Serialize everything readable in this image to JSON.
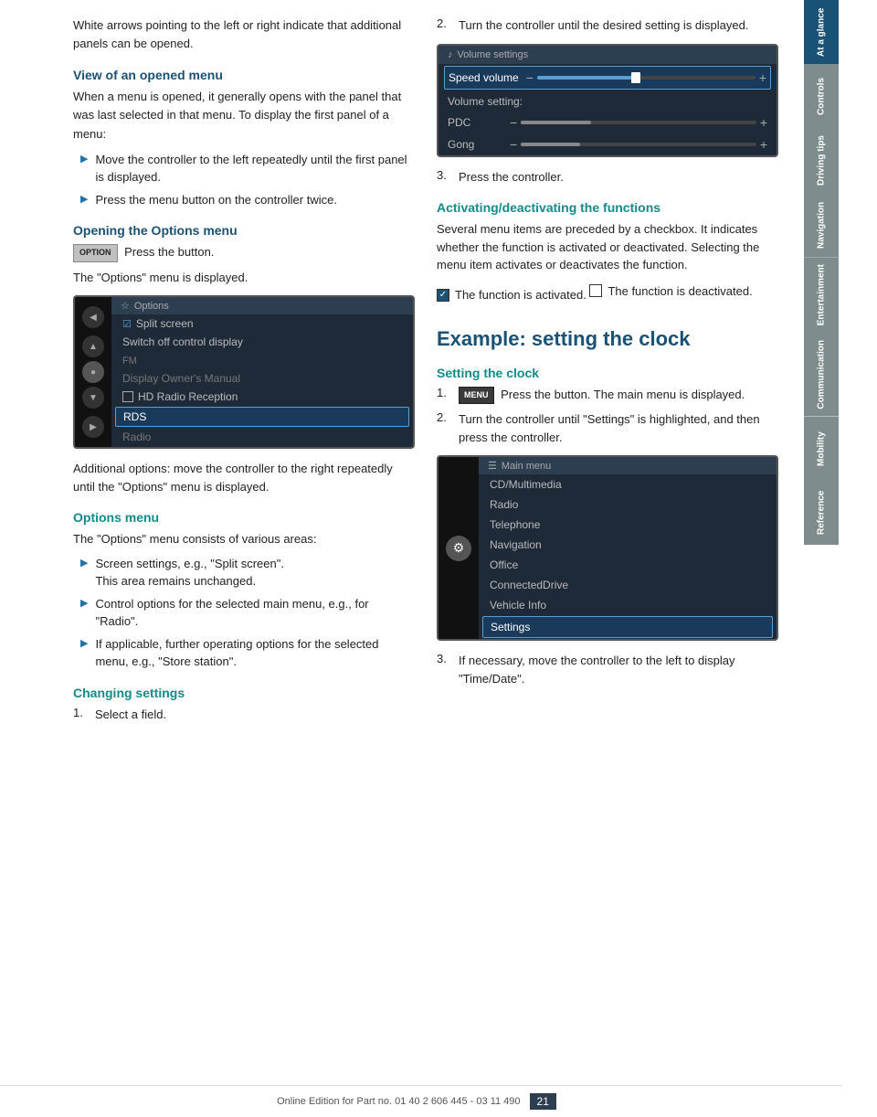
{
  "page": {
    "number": "21",
    "footer_text": "Online Edition for Part no. 01 40 2 606 445 - 03 11 490"
  },
  "sidebar": {
    "tabs": [
      {
        "id": "at-a-glance",
        "label": "At a glance",
        "active": true
      },
      {
        "id": "controls",
        "label": "Controls",
        "active": false
      },
      {
        "id": "driving-tips",
        "label": "Driving tips",
        "active": false
      },
      {
        "id": "navigation",
        "label": "Navigation",
        "active": false
      },
      {
        "id": "entertainment",
        "label": "Entertainment",
        "active": false
      },
      {
        "id": "communication",
        "label": "Communication",
        "active": false
      },
      {
        "id": "mobility",
        "label": "Mobility",
        "active": false
      },
      {
        "id": "reference",
        "label": "Reference",
        "active": false
      }
    ]
  },
  "left_col": {
    "intro": "White arrows pointing to the left or right indicate that additional panels can be opened.",
    "view_menu_heading": "View of an opened menu",
    "view_menu_text": "When a menu is opened, it generally opens with the panel that was last selected in that menu. To display the first panel of a menu:",
    "bullet1": "Move the controller to the left repeatedly until the first panel is displayed.",
    "bullet2": "Press the menu button on the controller twice.",
    "opening_options_heading": "Opening the Options menu",
    "option_btn_label": "OPTION",
    "press_button_text": "Press the button.",
    "options_displayed_text": "The \"Options\" menu is displayed.",
    "options_screen": {
      "header_icon": "☆",
      "header_label": "Options",
      "items": [
        {
          "text": "Split screen",
          "type": "checked"
        },
        {
          "text": "Switch off control display",
          "type": "normal"
        },
        {
          "text": "FM",
          "type": "section"
        },
        {
          "text": "Display Owner's Manual",
          "type": "normal"
        },
        {
          "text": "HD Radio Reception",
          "type": "checkbox",
          "checked": false
        },
        {
          "text": "RDS",
          "type": "highlighted"
        },
        {
          "text": "Radio",
          "type": "dimmed"
        }
      ]
    },
    "additional_options_text": "Additional options: move the controller to the right repeatedly until the \"Options\" menu is displayed.",
    "options_menu_heading": "Options menu",
    "options_menu_intro": "The \"Options\" menu consists of various areas:",
    "options_bullet1": "Screen settings, e.g., \"Split screen\".",
    "options_bullet1_sub": "This area remains unchanged.",
    "options_bullet2": "Control options for the selected main menu, e.g., for \"Radio\".",
    "options_bullet3": "If applicable, further operating options for the selected menu, e.g., \"Store station\".",
    "changing_settings_heading": "Changing settings",
    "step1": "Select a field."
  },
  "right_col": {
    "step2": "Turn the controller until the desired setting is displayed.",
    "vol_screen": {
      "header_icon": "♪",
      "header_label": "Volume settings",
      "speed_volume_label": "Speed volume",
      "volume_setting_label": "Volume setting:",
      "pdc_label": "PDC",
      "gong_label": "Gong",
      "slider_fill_pct": 45,
      "pdc_fill_pct": 30,
      "gong_fill_pct": 25
    },
    "step3": "Press the controller.",
    "activating_heading": "Activating/deactivating the functions",
    "activating_text": "Several menu items are preceded by a checkbox. It indicates whether the function is activated or deactivated. Selecting the menu item activates or deactivates the function.",
    "activated_label": "The function is activated.",
    "deactivated_label": "The function is deactivated.",
    "example_heading": "Example: setting the clock",
    "setting_clock_heading": "Setting the clock",
    "clock_step1_btn": "MENU",
    "clock_step1_text": "Press the button. The main menu is displayed.",
    "clock_step2_text": "Turn the controller until \"Settings\" is highlighted, and then press the controller.",
    "mainmenu_screen": {
      "header_icon": "☰",
      "header_label": "Main menu",
      "items": [
        "CD/Multimedia",
        "Radio",
        "Telephone",
        "Navigation",
        "Office",
        "ConnectedDrive",
        "Vehicle Info",
        "Settings"
      ],
      "highlighted_item": "Settings"
    },
    "clock_step3_text": "If necessary, move the controller to the left to display \"Time/Date\"."
  }
}
